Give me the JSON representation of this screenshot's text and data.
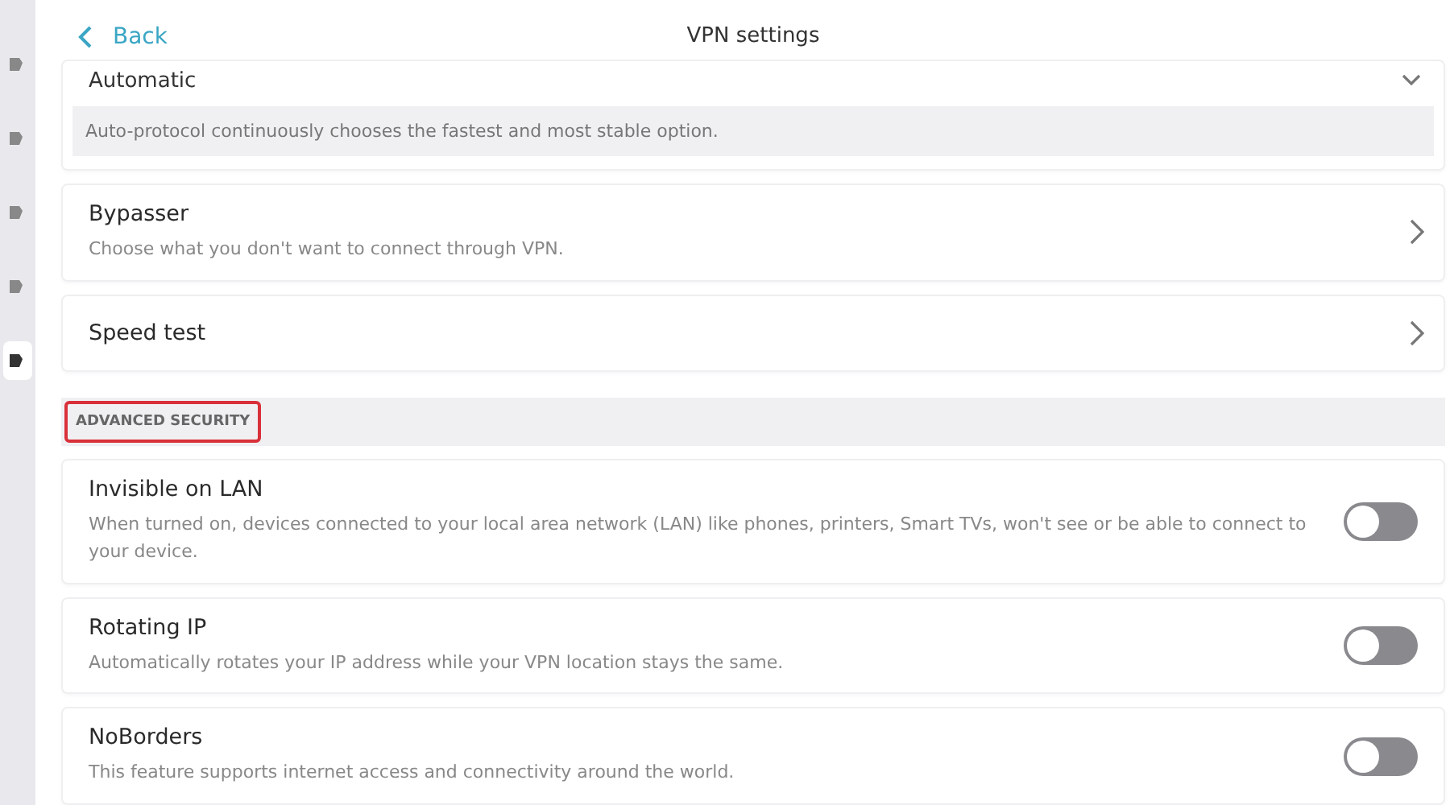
{
  "sidebar": {
    "items": [
      {
        "selected": false
      },
      {
        "selected": false
      },
      {
        "selected": false
      },
      {
        "selected": false
      },
      {
        "selected": true
      }
    ]
  },
  "header": {
    "back": "Back",
    "title": "VPN settings"
  },
  "protocol": {
    "value": "Automatic",
    "note": "Auto-protocol continuously chooses the fastest and most stable option."
  },
  "links": [
    {
      "title": "Bypasser",
      "description": "Choose what you don't want to connect through VPN."
    },
    {
      "title": "Speed test"
    }
  ],
  "section": {
    "label": "ADVANCED SECURITY",
    "highlighted": true
  },
  "toggles": [
    {
      "title": "Invisible on LAN",
      "description": "When turned on, devices connected to your local area network (LAN) like phones, printers, Smart TVs, won't see or be able to connect to your device.",
      "on": false
    },
    {
      "title": "Rotating IP",
      "description": "Automatically rotates your IP address while your VPN location stays the same.",
      "on": false
    },
    {
      "title": "NoBorders",
      "description": "This feature supports internet access and connectivity around the world.",
      "on": false
    }
  ]
}
